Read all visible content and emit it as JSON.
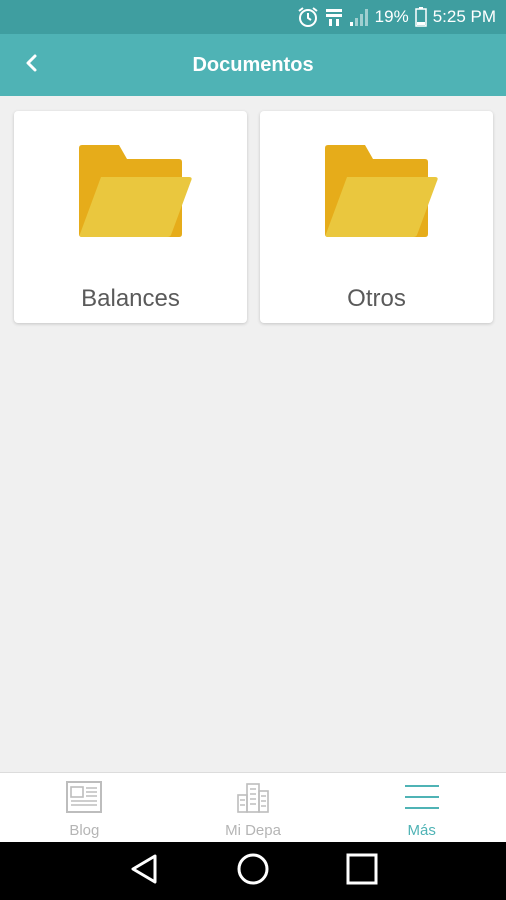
{
  "status_bar": {
    "battery_percent": "19%",
    "time": "5:25 PM",
    "icons": [
      "alarm-icon",
      "network-icon",
      "signal-icon",
      "battery-icon"
    ]
  },
  "app_bar": {
    "title": "Documentos",
    "back_icon": "chevron-left-icon"
  },
  "folders": [
    {
      "label": "Balances",
      "icon": "folder-icon"
    },
    {
      "label": "Otros",
      "icon": "folder-icon"
    }
  ],
  "bottom_nav": {
    "items": [
      {
        "label": "Blog",
        "icon": "newspaper-icon",
        "active": false
      },
      {
        "label": "Mi Depa",
        "icon": "buildings-icon",
        "active": false
      },
      {
        "label": "Más",
        "icon": "menu-icon",
        "active": true
      }
    ]
  },
  "colors": {
    "status_bar": "#3f9ea0",
    "app_bar": "#4fb3b5",
    "accent": "#4fb3b5",
    "folder_back": "#e6ac1a",
    "folder_front": "#eac73e",
    "background": "#f0f0f0"
  }
}
